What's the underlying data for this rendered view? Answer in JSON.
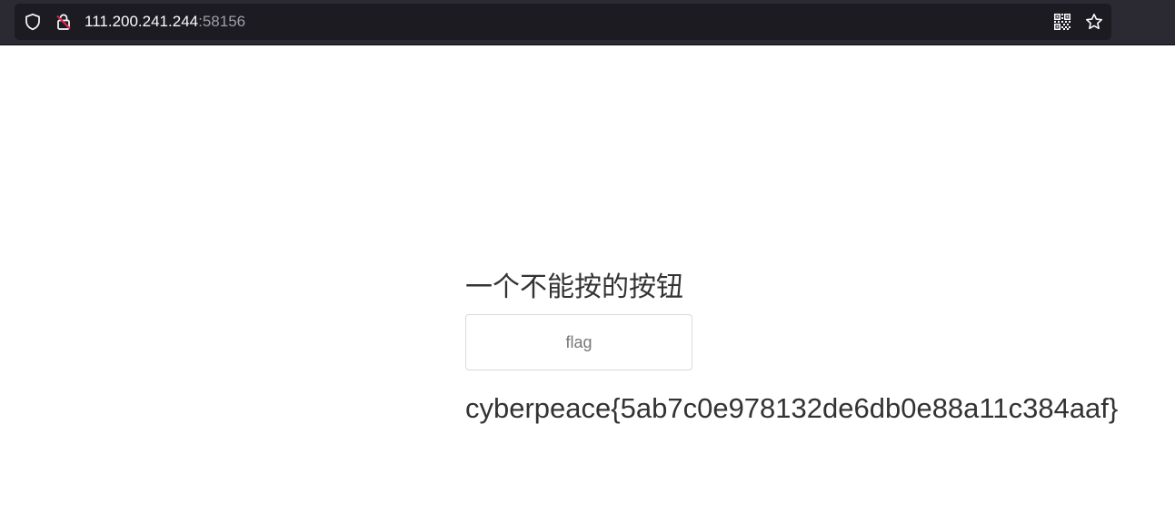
{
  "browser": {
    "url_host": "111.200.241.244",
    "url_port": ":58156",
    "icons": {
      "shield": "shield-icon",
      "insecure_lock": "insecure-lock-icon",
      "qr_code": "qr-code-icon",
      "bookmark_star": "bookmark-star-icon"
    }
  },
  "page": {
    "title": "一个不能按的按钮",
    "button_label": "flag",
    "flag_value": "cyberpeace{5ab7c0e978132de6db0e88a11c384aaf}"
  },
  "colors": {
    "chrome_bg": "#2b2a33",
    "urlbar_bg": "#1c1b22",
    "insecure_accent": "#e22850",
    "text": "#333333"
  }
}
